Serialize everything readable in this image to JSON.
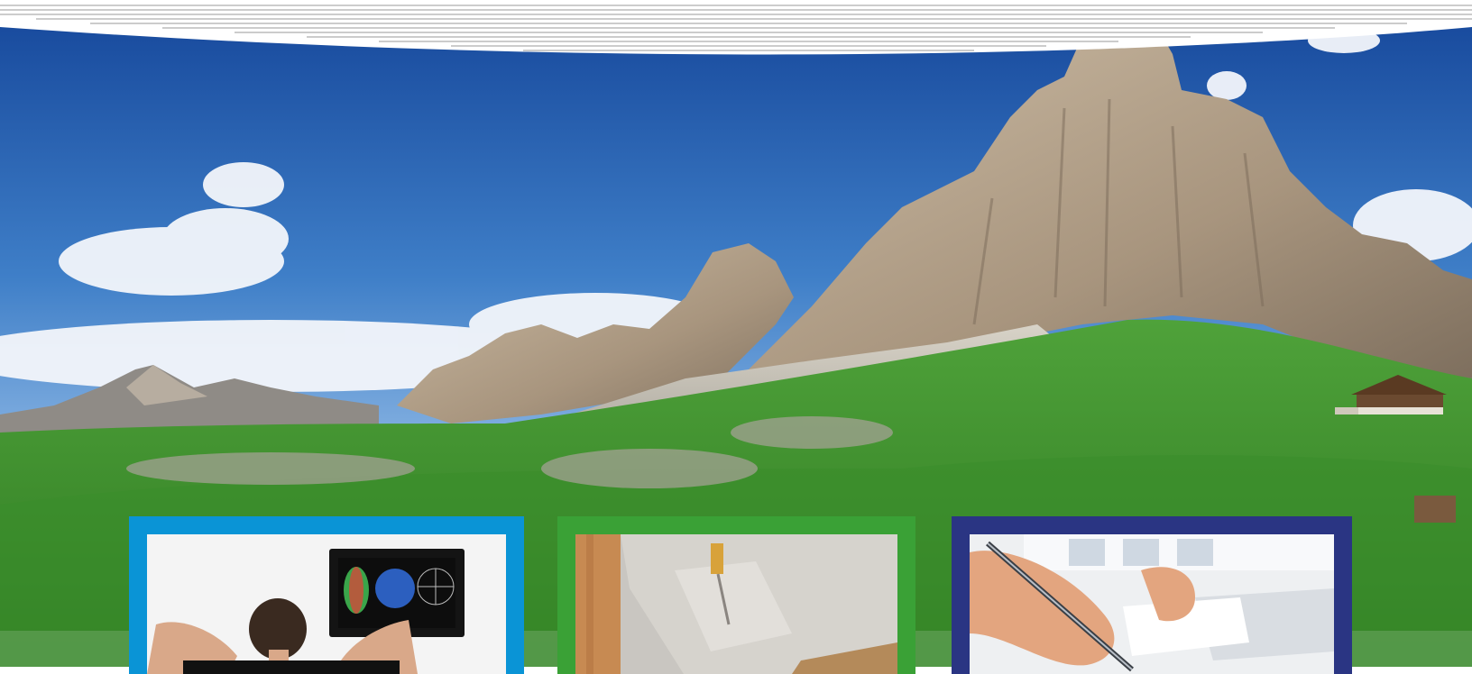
{
  "scene": {
    "description_icons": [
      "mountain-panorama",
      "alpine-meadow",
      "chalet"
    ],
    "colors": {
      "sky_top": "#1a4f9e",
      "sky_bottom": "#6d9fd8",
      "rock": "#bfae98",
      "rock_shadow": "#8c7c6a",
      "meadow": "#3e8f2c",
      "meadow_dark": "#2c6a1f"
    }
  },
  "cards": [
    {
      "id": "card-software",
      "icon": "monitor-with-charts-icon",
      "border_color": "#0a94d6"
    },
    {
      "id": "card-inspection",
      "icon": "surface-sample-icon",
      "border_color": "#3aa136"
    },
    {
      "id": "card-paperwork",
      "icon": "hand-writing-icon",
      "border_color": "#2a3583"
    }
  ]
}
